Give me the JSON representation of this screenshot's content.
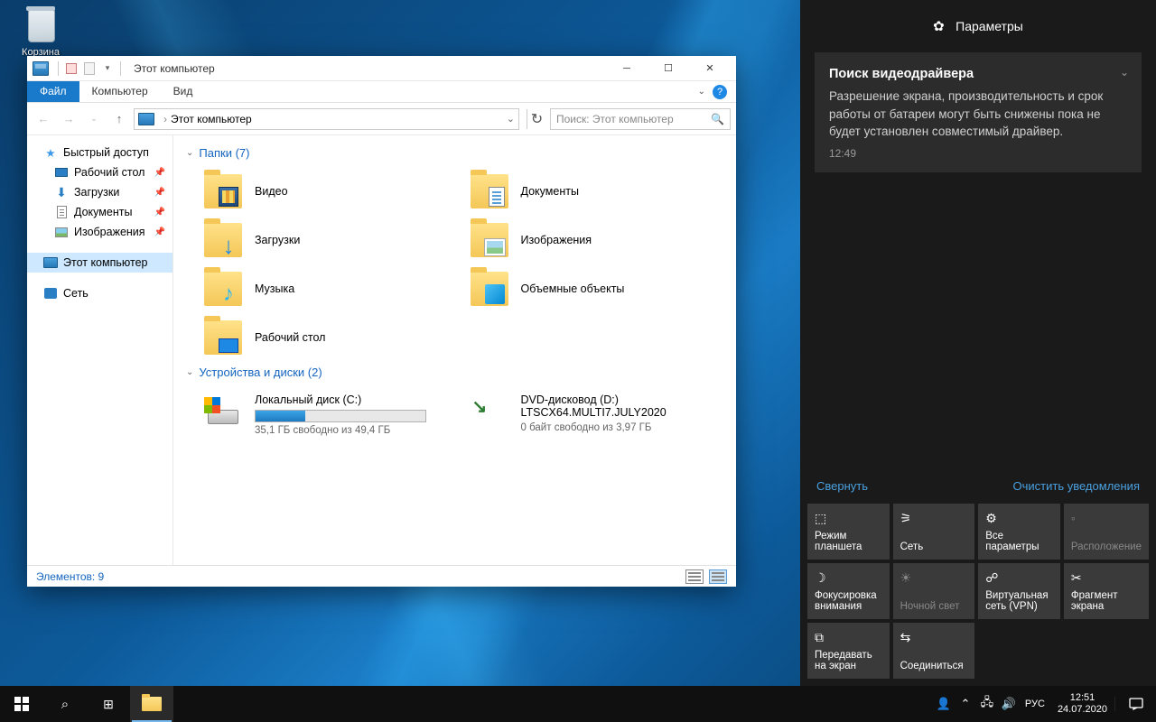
{
  "desktop": {
    "recycle_bin_label": "Корзина"
  },
  "explorer": {
    "title": "Этот компьютер",
    "tabs": {
      "file": "Файл",
      "computer": "Компьютер",
      "view": "Вид"
    },
    "address": {
      "root": "Этот компьютер"
    },
    "search_placeholder": "Поиск: Этот компьютер",
    "sidebar": {
      "quick_access": "Быстрый доступ",
      "desktop": "Рабочий стол",
      "downloads": "Загрузки",
      "documents": "Документы",
      "pictures": "Изображения",
      "this_pc": "Этот компьютер",
      "network": "Сеть"
    },
    "sections": {
      "folders_hdr": "Папки (7)",
      "drives_hdr": "Устройства и диски (2)"
    },
    "folders": {
      "video": "Видео",
      "documents": "Документы",
      "downloads": "Загрузки",
      "pictures": "Изображения",
      "music": "Музыка",
      "objects3d": "Объемные объекты",
      "desktop": "Рабочий стол"
    },
    "drives": {
      "c": {
        "name": "Локальный диск (C:)",
        "free": "35,1 ГБ свободно из 49,4 ГБ",
        "fill_pct": 29
      },
      "d": {
        "name": "DVD-дисковод (D:)",
        "label": "LTSCX64.MULTI7.JULY2020",
        "free": "0 байт свободно из 3,97 ГБ"
      }
    },
    "status": "Элементов: 9"
  },
  "action_center": {
    "title": "Параметры",
    "notif": {
      "title": "Поиск видеодрайвера",
      "body": "Разрешение экрана, производительность и срок работы от батареи могут быть снижены пока не будет установлен совместимый драйвер.",
      "time": "12:49"
    },
    "collapse": "Свернуть",
    "clear": "Очистить уведомления",
    "qa": {
      "tablet": "Режим планшета",
      "network": "Сеть",
      "all": "Все параметры",
      "location": "Расположение",
      "focus": "Фокусировка внимания",
      "night": "Ночной свет",
      "vpn": "Виртуальная сеть (VPN)",
      "snip": "Фрагмент экрана",
      "project": "Передавать на экран",
      "connect": "Соединиться"
    }
  },
  "taskbar": {
    "lang": "РУС",
    "time": "12:51",
    "date": "24.07.2020"
  }
}
